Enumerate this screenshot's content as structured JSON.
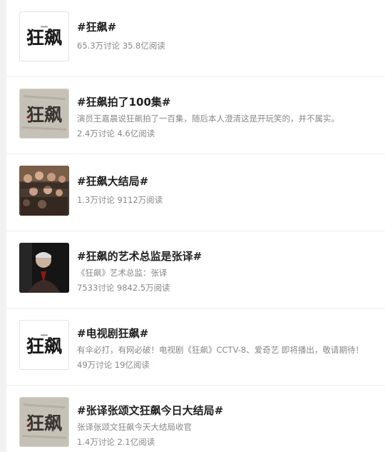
{
  "topics": [
    {
      "title": "#狂飙#",
      "description": "",
      "stats": "65.3万讨论 35.8亿阅读",
      "thumbnail": "logo-calligraphy",
      "logo_text": "狂飙"
    },
    {
      "title": "#狂飙拍了100集#",
      "description": "演员王嘉晨说狂飙拍了一百集，随后本人澄清这是开玩笑的，并不属实。",
      "stats": "2.4万讨论 4.6亿阅读",
      "thumbnail": "logo-on-paper",
      "logo_text": "狂飙"
    },
    {
      "title": "#狂飙大结局#",
      "description": "",
      "stats": "1.3万讨论 9112万阅读",
      "thumbnail": "cast-poster"
    },
    {
      "title": "#狂飙的艺术总监是张译#",
      "description": "《狂飙》艺术总监：张译",
      "stats": "7533讨论 9842.5万阅读",
      "thumbnail": "portrait-photo"
    },
    {
      "title": "#电视剧狂飙#",
      "description": "有伞必打，有网必破！电视剧《狂飙》CCTV-8、爱奇艺 即将播出，敬请期待！",
      "stats": "49万讨论 19亿阅读",
      "thumbnail": "logo-calligraphy",
      "logo_text": "狂飙"
    },
    {
      "title": "#张译张颂文狂飙今日大结局#",
      "description": "张译张颂文狂飙今天大结局收官",
      "stats": "1.4万讨论 2.1亿阅读",
      "thumbnail": "logo-on-paper",
      "logo_text": "狂飙"
    }
  ]
}
